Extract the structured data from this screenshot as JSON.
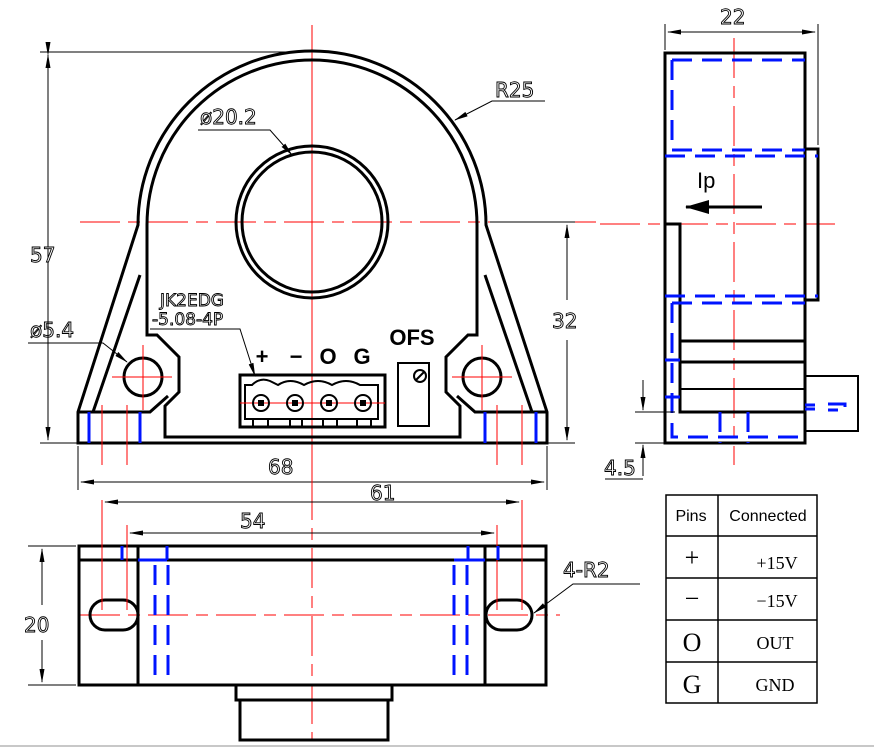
{
  "dimensions": {
    "height_total": "57",
    "center_height": "32",
    "base_width": "68",
    "outer_radius": "R25",
    "aperture_diameter": "ø20.2",
    "mount_hole_diameter": "ø5.4",
    "side_depth": "22",
    "side_offset": "4.5",
    "slot_outer_span": "61",
    "slot_inner_span": "54",
    "bottom_depth": "20",
    "slot_radius": "4-R2"
  },
  "connector": {
    "part_line1": "JK2EDG",
    "part_line2": "-5.08-4P",
    "pin_labels": [
      "+",
      "−",
      "O",
      "G"
    ]
  },
  "offset_label": "OFS",
  "current_label": "Ip",
  "pin_table": {
    "headers": [
      "Pins",
      "Connected"
    ],
    "rows": [
      {
        "pin": "+",
        "connected": "+15V"
      },
      {
        "pin": "−",
        "connected": "−15V"
      },
      {
        "pin": "O",
        "connected": "OUT"
      },
      {
        "pin": "G",
        "connected": "GND"
      }
    ]
  },
  "colors": {
    "outline": "#000000",
    "centerline": "#ff0000",
    "hidden": "#0014ff"
  }
}
